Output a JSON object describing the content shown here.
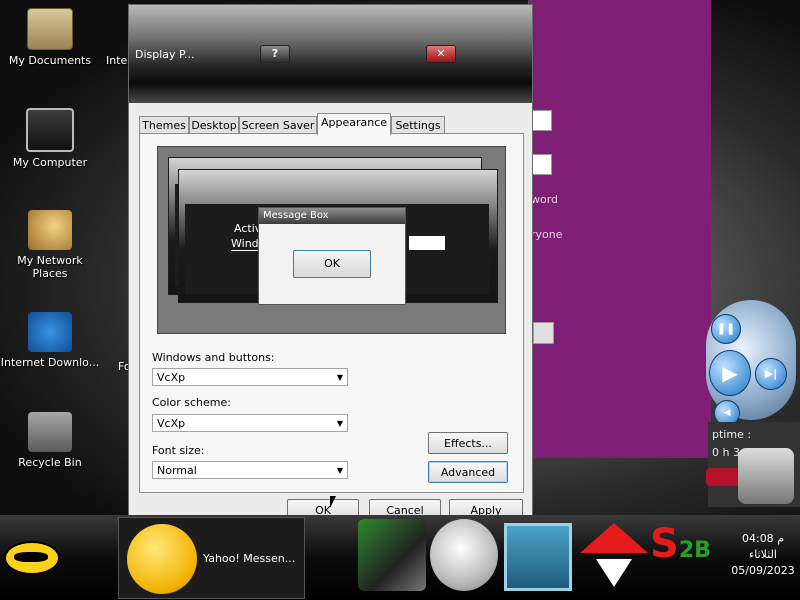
{
  "desktop": {
    "icons": [
      {
        "label": "My Documents",
        "icon": "folder-documents-icon"
      },
      {
        "label": "My Computer",
        "icon": "computer-icon"
      },
      {
        "label": "My Network Places",
        "icon": "network-places-icon"
      },
      {
        "label": "Internet Downlo...",
        "icon": "internet-download-manager-icon"
      },
      {
        "label": "Recycle Bin",
        "icon": "recycle-bin-icon"
      }
    ],
    "partial_labels": [
      "Inte",
      "Fo"
    ]
  },
  "purple_window": {
    "text_1": "word",
    "text_2": "ryone"
  },
  "uptime_widget": {
    "label": "ptime :",
    "value": "0 h 3 min"
  },
  "dialog": {
    "title": "Display P...",
    "help_label": "?",
    "close_label": "✕",
    "tabs": [
      "Themes",
      "Desktop",
      "Screen Saver",
      "Appearance",
      "Settings"
    ],
    "active_tab": "Appearance",
    "preview": {
      "active_window_label": "Activ",
      "window_text_label": "Windo",
      "message_box_title": "Message Box",
      "message_box_ok": "OK"
    },
    "windows_and_buttons": {
      "label": "Windows and buttons:",
      "value": "VcXp"
    },
    "color_scheme": {
      "label": "Color scheme:",
      "value": "VcXp"
    },
    "font_size": {
      "label": "Font size:",
      "value": "Normal"
    },
    "effects_label": "Effects...",
    "advanced_label": "Advanced",
    "ok_label": "OK",
    "cancel_label": "Cancel",
    "apply_label": "Apply"
  },
  "taskbar": {
    "start_icon": "batman-logo-icon",
    "task_item_label": "Yahoo! Messen...",
    "tray_icons": [
      "app-tray-icon",
      "face-tray-icon",
      "monitor-tray-icon",
      "upload-download-tray-icon",
      "s2b-tray-icon"
    ],
    "clock": {
      "time": "04:08 م",
      "day": "الثلاثاء",
      "date": "05/09/2023"
    }
  }
}
